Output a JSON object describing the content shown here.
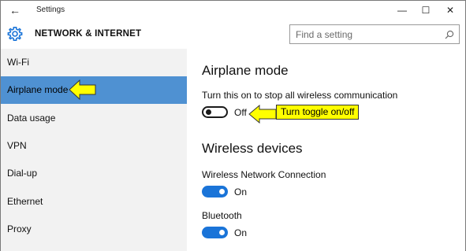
{
  "window": {
    "title": "Settings",
    "back_glyph": "←",
    "minimize_glyph": "—",
    "maximize_glyph": "☐",
    "close_glyph": "✕"
  },
  "header": {
    "icon": "gear-icon",
    "title": "NETWORK & INTERNET",
    "search_placeholder": "Find a setting",
    "search_value": ""
  },
  "sidebar": {
    "items": [
      {
        "label": "Wi-Fi",
        "selected": false
      },
      {
        "label": "Airplane mode",
        "selected": true
      },
      {
        "label": "Data usage",
        "selected": false
      },
      {
        "label": "VPN",
        "selected": false
      },
      {
        "label": "Dial-up",
        "selected": false
      },
      {
        "label": "Ethernet",
        "selected": false
      },
      {
        "label": "Proxy",
        "selected": false
      }
    ],
    "selected_color": "#4f91d2"
  },
  "main": {
    "airplane": {
      "title": "Airplane mode",
      "description": "Turn this on to stop all wireless communication",
      "toggle_state": "Off",
      "toggle_on": false
    },
    "wireless": {
      "title": "Wireless devices",
      "devices": [
        {
          "name": "Wireless Network Connection",
          "state": "On",
          "on": true
        },
        {
          "name": "Bluetooth",
          "state": "On",
          "on": true
        }
      ]
    }
  },
  "annotations": {
    "toggle_callout": "Turn toggle on/off",
    "callout_color": "#ffff00"
  },
  "colors": {
    "accent": "#1a74d8",
    "sidebar_bg": "#f2f2f2"
  }
}
